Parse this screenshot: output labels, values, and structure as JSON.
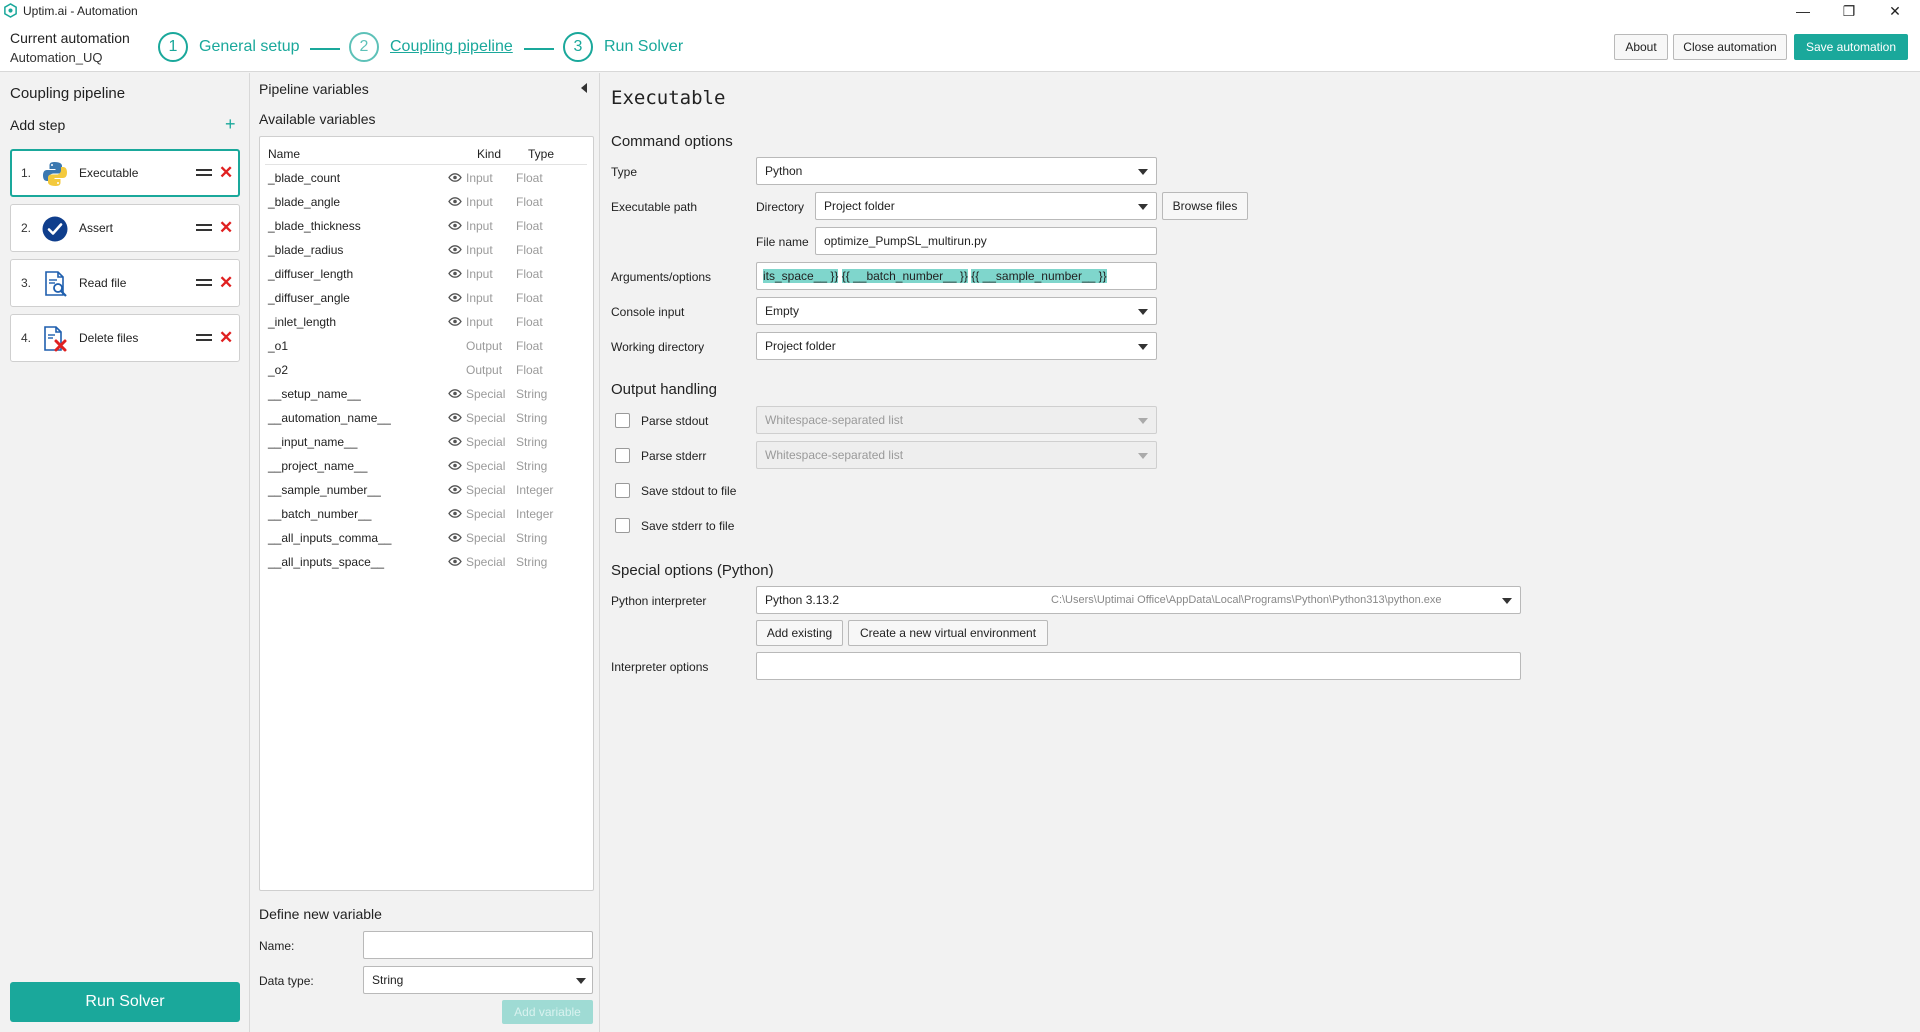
{
  "window": {
    "title": "Uptim.ai - Automation",
    "controls": {
      "minimize": "—",
      "maximize": "❐",
      "close": "✕"
    }
  },
  "header": {
    "current_label": "Current automation",
    "current_name": "Automation_UQ",
    "steps": [
      {
        "num": "1",
        "label": "General setup"
      },
      {
        "num": "2",
        "label": "Coupling pipeline"
      },
      {
        "num": "3",
        "label": "Run Solver"
      }
    ],
    "buttons": {
      "about": "About",
      "close": "Close automation",
      "save": "Save automation"
    },
    "accent": "#1aa89b"
  },
  "left": {
    "title": "Coupling pipeline",
    "add_step": "Add step",
    "add_icon": "+",
    "steps": [
      {
        "num": "1.",
        "label": "Executable",
        "icon": "python-icon"
      },
      {
        "num": "2.",
        "label": "Assert",
        "icon": "check-circle-icon"
      },
      {
        "num": "3.",
        "label": "Read file",
        "icon": "file-search-icon"
      },
      {
        "num": "4.",
        "label": "Delete files",
        "icon": "file-delete-icon"
      }
    ],
    "delete_glyph": "✕",
    "run_solver": "Run Solver"
  },
  "middle": {
    "title": "Pipeline variables",
    "available": "Available variables",
    "columns": {
      "name": "Name",
      "kind": "Kind",
      "type": "Type"
    },
    "rows": [
      {
        "name": "_blade_count",
        "kind": "Input",
        "type": "Float",
        "eye": true
      },
      {
        "name": "_blade_angle",
        "kind": "Input",
        "type": "Float",
        "eye": true
      },
      {
        "name": "_blade_thickness",
        "kind": "Input",
        "type": "Float",
        "eye": true
      },
      {
        "name": "_blade_radius",
        "kind": "Input",
        "type": "Float",
        "eye": true
      },
      {
        "name": "_diffuser_length",
        "kind": "Input",
        "type": "Float",
        "eye": true
      },
      {
        "name": "_diffuser_angle",
        "kind": "Input",
        "type": "Float",
        "eye": true
      },
      {
        "name": "_inlet_length",
        "kind": "Input",
        "type": "Float",
        "eye": true
      },
      {
        "name": "_o1",
        "kind": "Output",
        "type": "Float",
        "eye": false
      },
      {
        "name": "_o2",
        "kind": "Output",
        "type": "Float",
        "eye": false
      },
      {
        "name": "__setup_name__",
        "kind": "Special",
        "type": "String",
        "eye": true
      },
      {
        "name": "__automation_name__",
        "kind": "Special",
        "type": "String",
        "eye": true
      },
      {
        "name": "__input_name__",
        "kind": "Special",
        "type": "String",
        "eye": true
      },
      {
        "name": "__project_name__",
        "kind": "Special",
        "type": "String",
        "eye": true
      },
      {
        "name": "__sample_number__",
        "kind": "Special",
        "type": "Integer",
        "eye": true
      },
      {
        "name": "__batch_number__",
        "kind": "Special",
        "type": "Integer",
        "eye": true
      },
      {
        "name": "__all_inputs_comma__",
        "kind": "Special",
        "type": "String",
        "eye": true
      },
      {
        "name": "__all_inputs_space__",
        "kind": "Special",
        "type": "String",
        "eye": true
      }
    ],
    "define": {
      "title": "Define new variable",
      "name_label": "Name:",
      "name_value": "",
      "type_label": "Data type:",
      "type_value": "String",
      "add_button": "Add variable"
    }
  },
  "right": {
    "title": "Executable",
    "command_options": "Command options",
    "type_label": "Type",
    "type_value": "Python",
    "exec_path_label": "Executable path",
    "directory_label": "Directory",
    "directory_value": "Project folder",
    "browse_button": "Browse files",
    "filename_label": "File name",
    "filename_value": "optimize_PumpSL_multirun.py",
    "args_label": "Arguments/options",
    "args_parts": [
      "its_space__ }}",
      " ",
      "{{ __batch_number__ }}",
      " ",
      "{{ __sample_number__ }}"
    ],
    "console_label": "Console input",
    "console_value": "Empty",
    "workdir_label": "Working directory",
    "workdir_value": "Project folder",
    "output_handling": "Output handling",
    "parse_stdout": "Parse stdout",
    "parse_stdout_value": "Whitespace-separated list",
    "parse_stderr": "Parse stderr",
    "parse_stderr_value": "Whitespace-separated list",
    "save_stdout": "Save stdout to file",
    "save_stderr": "Save stderr to file",
    "special_options": "Special options (Python)",
    "interpreter_label": "Python interpreter",
    "interpreter_version": "Python 3.13.2",
    "interpreter_path": "C:\\Users\\Uptimai Office\\AppData\\Local\\Programs\\Python\\Python313\\python.exe",
    "add_existing": "Add existing",
    "create_venv": "Create a new virtual environment",
    "interp_options_label": "Interpreter options",
    "interp_options_value": ""
  }
}
